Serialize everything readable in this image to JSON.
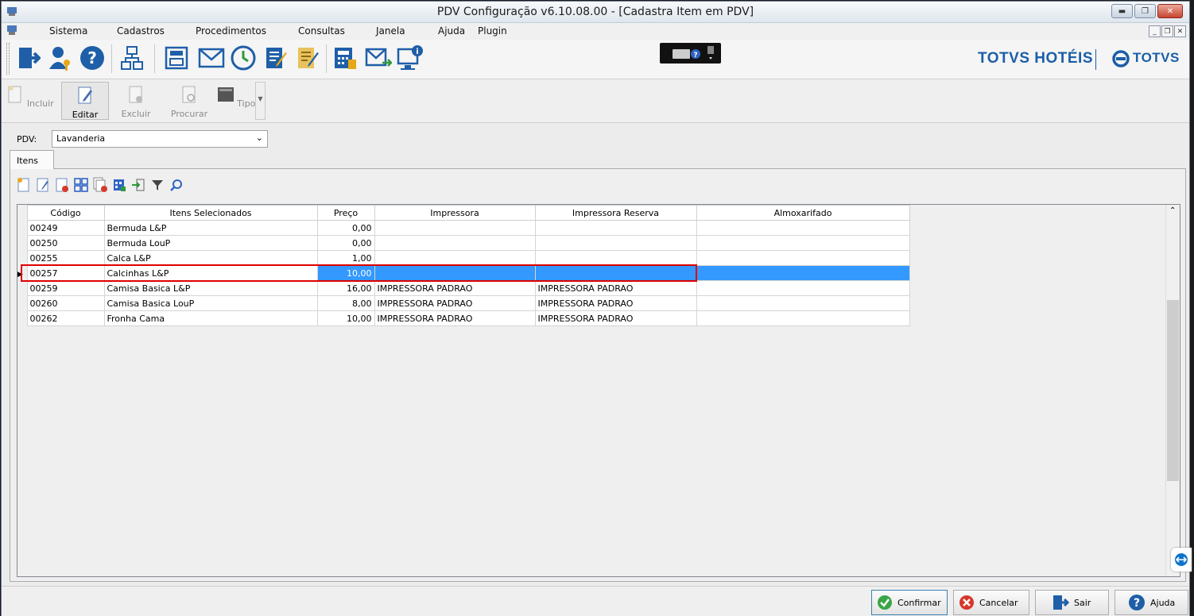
{
  "window": {
    "title": "PDV Configuração v6.10.08.00 - [Cadastra Item em PDV]"
  },
  "menu": [
    "Sistema",
    "Cadastros",
    "Procedimentos",
    "Consultas",
    "Janela",
    "Ajuda",
    "Plugin"
  ],
  "brand": {
    "left": "TOTVS HOTÉIS",
    "right": "TOTVS"
  },
  "actions": {
    "incluir": "Incluir",
    "editar": "Editar",
    "excluir": "Excluir",
    "procurar": "Procurar",
    "tipo": "Tipo"
  },
  "pdv": {
    "label": "PDV:",
    "value": "Lavanderia"
  },
  "tabs": [
    {
      "label": "Itens"
    }
  ],
  "grid": {
    "columns": [
      "Código",
      "Itens Selecionados",
      "Preço",
      "Impressora",
      "Impressora Reserva",
      "Almoxarifado"
    ],
    "rows": [
      {
        "codigo": "00249",
        "item": "Bermuda L&P",
        "preco": "0,00",
        "impressora": "",
        "reserva": "",
        "almox": ""
      },
      {
        "codigo": "00250",
        "item": "Bermuda LouP",
        "preco": "0,00",
        "impressora": "",
        "reserva": "",
        "almox": ""
      },
      {
        "codigo": "00255",
        "item": "Calca L&P",
        "preco": "1,00",
        "impressora": "",
        "reserva": "",
        "almox": ""
      },
      {
        "codigo": "00257",
        "item": "Calcinhas L&P",
        "preco": "10,00",
        "impressora": "",
        "reserva": "",
        "almox": ""
      },
      {
        "codigo": "00259",
        "item": "Camisa Basica L&P",
        "preco": "16,00",
        "impressora": "IMPRESSORA PADRAO",
        "reserva": "IMPRESSORA PADRAO",
        "almox": ""
      },
      {
        "codigo": "00260",
        "item": "Camisa Basica LouP",
        "preco": "8,00",
        "impressora": "IMPRESSORA PADRAO",
        "reserva": "IMPRESSORA PADRAO",
        "almox": ""
      },
      {
        "codigo": "00262",
        "item": "Fronha Cama",
        "preco": "10,00",
        "impressora": "IMPRESSORA PADRAO",
        "reserva": "IMPRESSORA PADRAO",
        "almox": ""
      }
    ],
    "selected_row": 3
  },
  "footer": {
    "confirmar": "Confirmar",
    "cancelar": "Cancelar",
    "sair": "Sair",
    "ajuda": "Ajuda"
  },
  "colors": {
    "selection": "#3399ff",
    "highlight_box": "#e00000",
    "brand": "#1b5ea8"
  }
}
